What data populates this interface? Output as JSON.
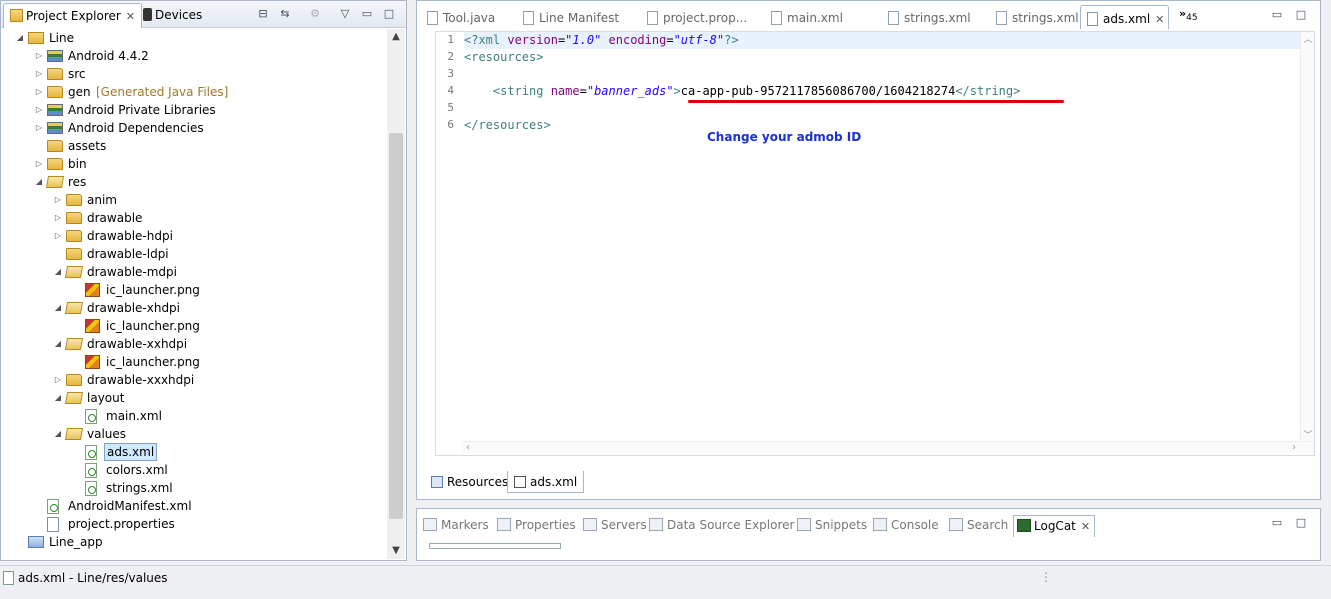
{
  "left_panel": {
    "tabs": [
      {
        "label": "Project Explorer",
        "icon": "project-explorer-icon"
      },
      {
        "label": "Devices",
        "icon": "devices-icon"
      }
    ],
    "tree": [
      {
        "label": "Line",
        "depth": 0,
        "twisty": "open",
        "icon": "project-icon"
      },
      {
        "label": "Android 4.4.2",
        "depth": 1,
        "twisty": "closed",
        "icon": "library-icon"
      },
      {
        "label": "src",
        "depth": 1,
        "twisty": "closed",
        "icon": "package-folder-icon"
      },
      {
        "label": "gen",
        "decoration": "[Generated Java Files]",
        "depth": 1,
        "twisty": "closed",
        "icon": "package-folder-icon"
      },
      {
        "label": "Android Private Libraries",
        "depth": 1,
        "twisty": "closed",
        "icon": "library-icon"
      },
      {
        "label": "Android Dependencies",
        "depth": 1,
        "twisty": "closed",
        "icon": "library-icon"
      },
      {
        "label": "assets",
        "depth": 1,
        "twisty": "none",
        "icon": "folder-icon"
      },
      {
        "label": "bin",
        "depth": 1,
        "twisty": "closed",
        "icon": "folder-icon"
      },
      {
        "label": "res",
        "depth": 1,
        "twisty": "open",
        "icon": "folder-open-icon"
      },
      {
        "label": "anim",
        "depth": 2,
        "twisty": "closed",
        "icon": "folder-icon"
      },
      {
        "label": "drawable",
        "depth": 2,
        "twisty": "closed",
        "icon": "folder-icon"
      },
      {
        "label": "drawable-hdpi",
        "depth": 2,
        "twisty": "closed",
        "icon": "folder-icon"
      },
      {
        "label": "drawable-ldpi",
        "depth": 2,
        "twisty": "none",
        "icon": "folder-icon"
      },
      {
        "label": "drawable-mdpi",
        "depth": 2,
        "twisty": "open",
        "icon": "folder-open-icon"
      },
      {
        "label": "ic_launcher.png",
        "depth": 3,
        "twisty": "none",
        "icon": "png-file-icon"
      },
      {
        "label": "drawable-xhdpi",
        "depth": 2,
        "twisty": "open",
        "icon": "folder-open-icon"
      },
      {
        "label": "ic_launcher.png",
        "depth": 3,
        "twisty": "none",
        "icon": "png-file-icon"
      },
      {
        "label": "drawable-xxhdpi",
        "depth": 2,
        "twisty": "open",
        "icon": "folder-open-icon"
      },
      {
        "label": "ic_launcher.png",
        "depth": 3,
        "twisty": "none",
        "icon": "png-file-icon"
      },
      {
        "label": "drawable-xxxhdpi",
        "depth": 2,
        "twisty": "closed",
        "icon": "folder-icon"
      },
      {
        "label": "layout",
        "depth": 2,
        "twisty": "open",
        "icon": "folder-open-icon"
      },
      {
        "label": "main.xml",
        "depth": 3,
        "twisty": "none",
        "icon": "xml-file-icon"
      },
      {
        "label": "values",
        "depth": 2,
        "twisty": "open",
        "icon": "folder-open-icon"
      },
      {
        "label": "ads.xml",
        "depth": 3,
        "twisty": "none",
        "icon": "xml-file-icon",
        "selected": true
      },
      {
        "label": "colors.xml",
        "depth": 3,
        "twisty": "none",
        "icon": "xml-file-icon"
      },
      {
        "label": "strings.xml",
        "depth": 3,
        "twisty": "none",
        "icon": "xml-file-icon"
      },
      {
        "label": "AndroidManifest.xml",
        "depth": 1,
        "twisty": "none",
        "icon": "xml-file-icon"
      },
      {
        "label": "project.properties",
        "depth": 1,
        "twisty": "none",
        "icon": "properties-file-icon"
      },
      {
        "label": "Line_app",
        "depth": 0,
        "twisty": "none",
        "icon": "project-icon-blue"
      }
    ]
  },
  "editor": {
    "tabs": [
      {
        "label": "Tool.java"
      },
      {
        "label": "Line Manifest"
      },
      {
        "label": "project.prop..."
      },
      {
        "label": "main.xml"
      },
      {
        "label": "strings.xml"
      },
      {
        "label": "strings.xml"
      },
      {
        "label": "ads.xml",
        "active": true
      }
    ],
    "overflow_label": "»",
    "overflow_count": "45",
    "line_numbers": [
      "1",
      "2",
      "3",
      "4",
      "5",
      "6"
    ],
    "code": {
      "l1_open": "<?xml ",
      "l1_attr1": "version",
      "l1_eq1": "=",
      "l1_val1": "\"1.0\"",
      "l1_attr2": " encoding",
      "l1_eq2": "=",
      "l1_val2": "\"utf-8\"",
      "l1_close": "?>",
      "l2": "<resources>",
      "l4_open": "<string ",
      "l4_attr": "name",
      "l4_eq": "=",
      "l4_val": "\"banner_ads\"",
      "l4_gt": ">",
      "l4_text": "ca-app-pub-9572117856086700/1604218274",
      "l4_close": "</string>",
      "l6": "</resources>"
    },
    "annotation": "Change your admob ID",
    "bottom_tabs": [
      {
        "label": "Resources"
      },
      {
        "label": "ads.xml",
        "active": true
      }
    ]
  },
  "bottom_views": {
    "tabs": [
      {
        "label": "Markers"
      },
      {
        "label": "Properties"
      },
      {
        "label": "Servers"
      },
      {
        "label": "Data Source Explorer"
      },
      {
        "label": "Snippets"
      },
      {
        "label": "Console"
      },
      {
        "label": "Search"
      },
      {
        "label": "LogCat",
        "active": true
      }
    ]
  },
  "status_bar": {
    "text": "ads.xml - Line/res/values",
    "separator": "⋮"
  },
  "colors": {
    "selection": "#cde8ff",
    "current_line": "#e8f2fe",
    "xml_tag": "#3f7f7f",
    "xml_attr": "#7f007f",
    "xml_value": "#2a00ff",
    "annotation": "#1a2fd6",
    "underline": "#e00000"
  }
}
